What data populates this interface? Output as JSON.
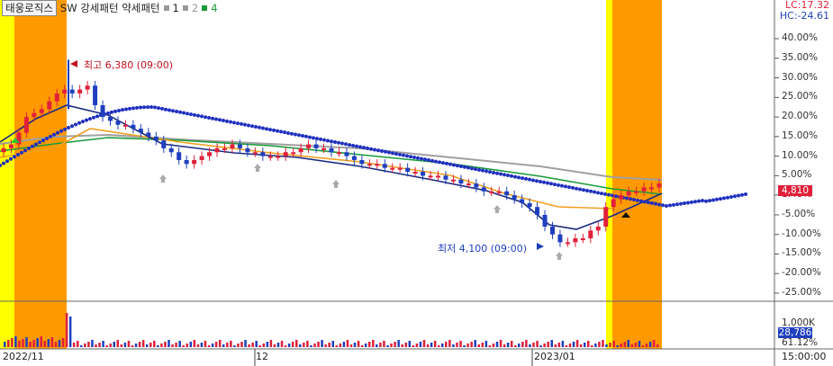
{
  "legend": {
    "stock_name": "태웅로직스",
    "indicator": "SW 강세패턴  약세패턴",
    "s1": "1",
    "s2": "2",
    "s3": "4"
  },
  "top_right": {
    "lc": "LC:17.32",
    "hc": "HC:-24.61"
  },
  "axis": {
    "labels": [
      "40.00%",
      "35.00%",
      "30.00%",
      "25.00%",
      "20.00%",
      "15.00%",
      "10.00%",
      "5.00%",
      "1.48%",
      "-5.00%",
      "-10.00%",
      "-15.00%",
      "-20.00%",
      "-25.00%"
    ],
    "current_price": "4,810",
    "volume_labels": [
      "1,000K",
      "28,786",
      "61.12%"
    ],
    "time": "15:00:00"
  },
  "dates": [
    "2022/11",
    "12",
    "2023/01"
  ],
  "annotations": {
    "high": "최고 6,380 (09:00)",
    "low": "최저 4,100 (09:00)"
  },
  "colors": {
    "highlight": "#ff9900",
    "yellow": "#ffff00",
    "up": "#e0203a",
    "down": "#1f3fbf",
    "ma_blue": "#1f2fbf",
    "ma_navy": "#1a2a80",
    "ma_orange": "#f0a020",
    "ma_green": "#1a9a3a",
    "ma_gray": "#a0a0a0"
  },
  "chart_data": {
    "type": "candlestick",
    "xlabel": "",
    "ylabel": "",
    "y_axis_unit": "%",
    "ylim": [
      -27,
      45
    ],
    "high_annotation": "최고 6,380 (09:00)",
    "low_annotation": "최저 4,100 (09:00)",
    "current_price": 4810,
    "price_series_pct": [
      12,
      13,
      16,
      20,
      21,
      22,
      24,
      26,
      27,
      26,
      27,
      28,
      23,
      20,
      19,
      18,
      18,
      17,
      16,
      15,
      14,
      12,
      11,
      9,
      8,
      9,
      10,
      11,
      12,
      12,
      13,
      12,
      11,
      11,
      10,
      10,
      10,
      11,
      11,
      12,
      13,
      12,
      12,
      11,
      11,
      10,
      9,
      8,
      8,
      8,
      7,
      7,
      7,
      6,
      6,
      5,
      5,
      5,
      4,
      4,
      3,
      3,
      2,
      1,
      1,
      1,
      0,
      -1,
      -2,
      -3,
      -5,
      -8,
      -10,
      -12,
      -12,
      -11,
      -11,
      -9,
      -8,
      -3,
      -1,
      0,
      1,
      1,
      2,
      2,
      3
    ]
  }
}
